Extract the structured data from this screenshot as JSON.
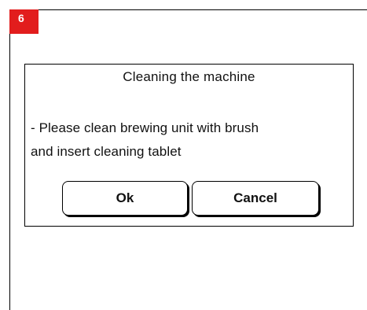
{
  "step": {
    "number": "6",
    "badge_color": "#e21d1d"
  },
  "dialog": {
    "title": "Cleaning the machine",
    "message_line1": "- Please clean brewing unit with brush",
    "message_line2": "and insert cleaning tablet",
    "ok_label": "Ok",
    "cancel_label": "Cancel"
  }
}
